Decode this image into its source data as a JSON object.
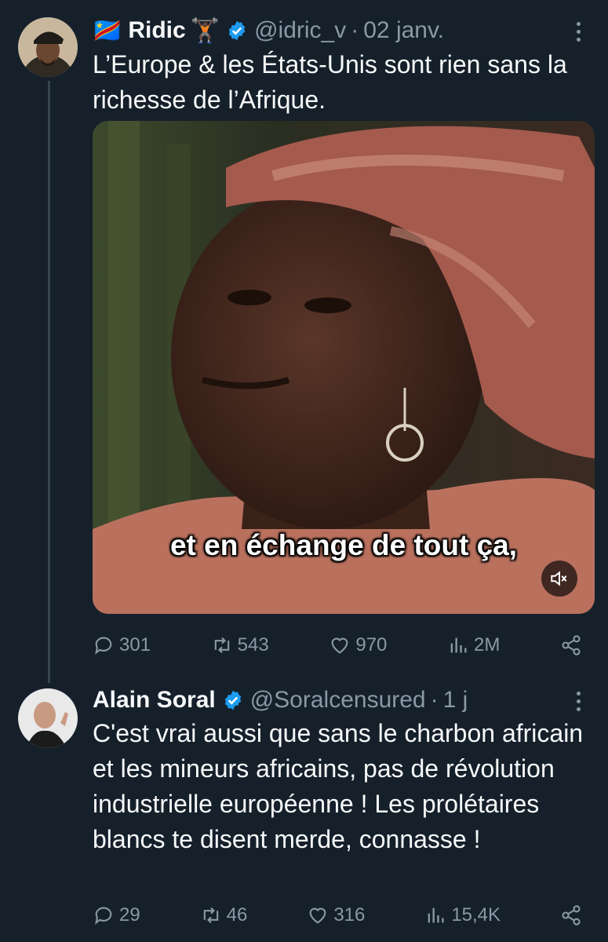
{
  "tweets": [
    {
      "flag": "🇨🇩",
      "name": "Ridic",
      "emoji": "🏋🏿",
      "handle": "@idric_v",
      "separator": "·",
      "date": "02 janv.",
      "text": "L’Europe & les États-Unis sont rien sans la richesse de l’Afrique.",
      "media": {
        "caption": "et en échange de tout ça,"
      },
      "stats": {
        "replies": "301",
        "retweets": "543",
        "likes": "970",
        "views": "2M"
      }
    },
    {
      "name": "Alain Soral",
      "handle": "@Soralcensured",
      "separator": "·",
      "date": "1 j",
      "text": "C'est vrai aussi que sans le charbon africain et les mineurs africains, pas de révolution industrielle européenne ! Les prolétaires blancs te disent merde, connasse !",
      "stats": {
        "replies": "29",
        "retweets": "46",
        "likes": "316",
        "views": "15,4K"
      }
    }
  ],
  "icons": {
    "verified": "verified-badge-icon",
    "reply": "reply-icon",
    "retweet": "retweet-icon",
    "like": "heart-icon",
    "views": "views-icon",
    "share": "share-icon",
    "more": "more-icon",
    "mute": "mute-icon"
  },
  "colors": {
    "background": "#15202b",
    "text": "#f7f9f9",
    "muted": "#8b98a5",
    "verified": "#1d9bf0"
  }
}
